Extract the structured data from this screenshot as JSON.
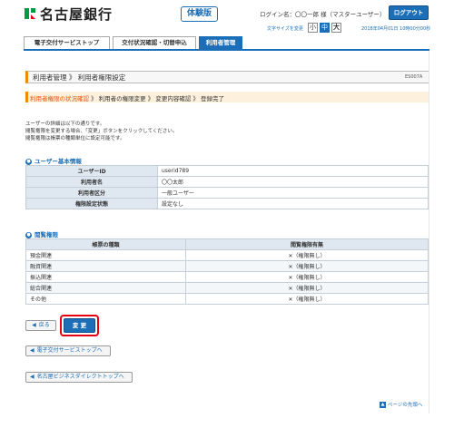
{
  "header": {
    "bank_name": "名古屋銀行",
    "trial_badge": "体験版",
    "login_name": "ログイン名：〇〇一郎 様（マスターユーザー）",
    "logout_label": "ログアウト",
    "font_size_label": "文字サイズを変更",
    "font_small": "小",
    "font_medium": "中",
    "font_large": "大",
    "datetime": "2018年04月01日 10時00分00秒"
  },
  "tabs": [
    {
      "label": "電子交付サービストップ"
    },
    {
      "label": "交付状況確認・切替申込"
    },
    {
      "label": "利用者管理"
    }
  ],
  "page": {
    "title": "利用者管理 》 利用者権限設定",
    "screen_id": "ES007A"
  },
  "steps": {
    "current": "利用者権限の状況確認",
    "rest": [
      "利用者の権限変更",
      "変更内容確認",
      "登録完了"
    ],
    "separator": "》"
  },
  "intro": {
    "line1": "ユーザーの詳細は以下の通りです。",
    "line2": "閲覧権限を変更する場合、「変更」ボタンをクリックしてください。",
    "line3": "閲覧権限は帳票の種類単位に設定可能です。"
  },
  "user_section": {
    "heading": "ユーザー基本情報",
    "rows": [
      {
        "key": "ユーザーID",
        "value": "userid789"
      },
      {
        "key": "利用者名",
        "value": "〇〇太郎"
      },
      {
        "key": "利用者区分",
        "value": "一般ユーザー"
      },
      {
        "key": "権限設定状態",
        "value": "設定なし"
      }
    ]
  },
  "perm_section": {
    "heading": "閲覧権限",
    "col_type": "帳票の種類",
    "col_perm": "閲覧権限有無",
    "rows": [
      {
        "type": "預金関連",
        "perm": "✕（権限無し）"
      },
      {
        "type": "融資関連",
        "perm": "✕（権限無し）"
      },
      {
        "type": "振込関連",
        "perm": "✕（権限無し）"
      },
      {
        "type": "総合関連",
        "perm": "✕（権限無し）"
      },
      {
        "type": "その他",
        "perm": "✕（権限無し）"
      }
    ]
  },
  "buttons": {
    "back": "戻る",
    "change": "変 更",
    "link1": "電子交付サービストップへ",
    "link2": "名古屋ビジネスダイレクトトップへ",
    "page_top": "ページの先頭へ"
  },
  "colors": {
    "accent_blue": "#1b6fb8",
    "accent_orange": "#f08a00",
    "highlight_red": "#e60012",
    "logo_green": "#009944"
  }
}
